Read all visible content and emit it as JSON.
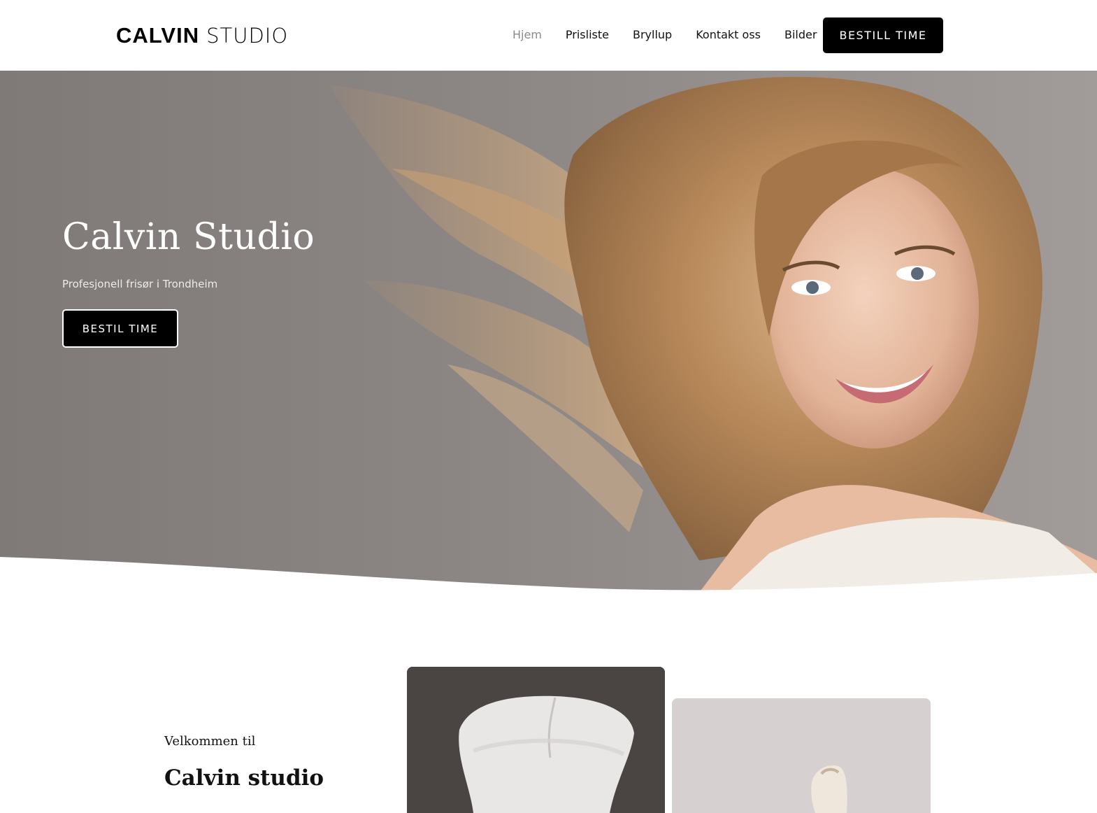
{
  "header": {
    "logo_bold": "CALVIN",
    "logo_light": "STUDIO",
    "nav": [
      {
        "label": "Hjem",
        "active": true
      },
      {
        "label": "Prisliste",
        "active": false
      },
      {
        "label": "Bryllup",
        "active": false
      },
      {
        "label": "Kontakt oss",
        "active": false
      },
      {
        "label": "Bilder",
        "active": false
      }
    ],
    "cta_label": "BESTILL TIME"
  },
  "hero": {
    "title": "Calvin Studio",
    "subtitle": "Profesjonell frisør i Trondheim",
    "button_label": "BESTIL TIME"
  },
  "intro": {
    "pre_title": "Velkommen til",
    "title": "Calvin studio"
  },
  "colors": {
    "brand_dark": "#000000",
    "hero_gray": "#8a8484",
    "nav_active": "#8a8a8a",
    "hair_gold": "#b8895a"
  }
}
